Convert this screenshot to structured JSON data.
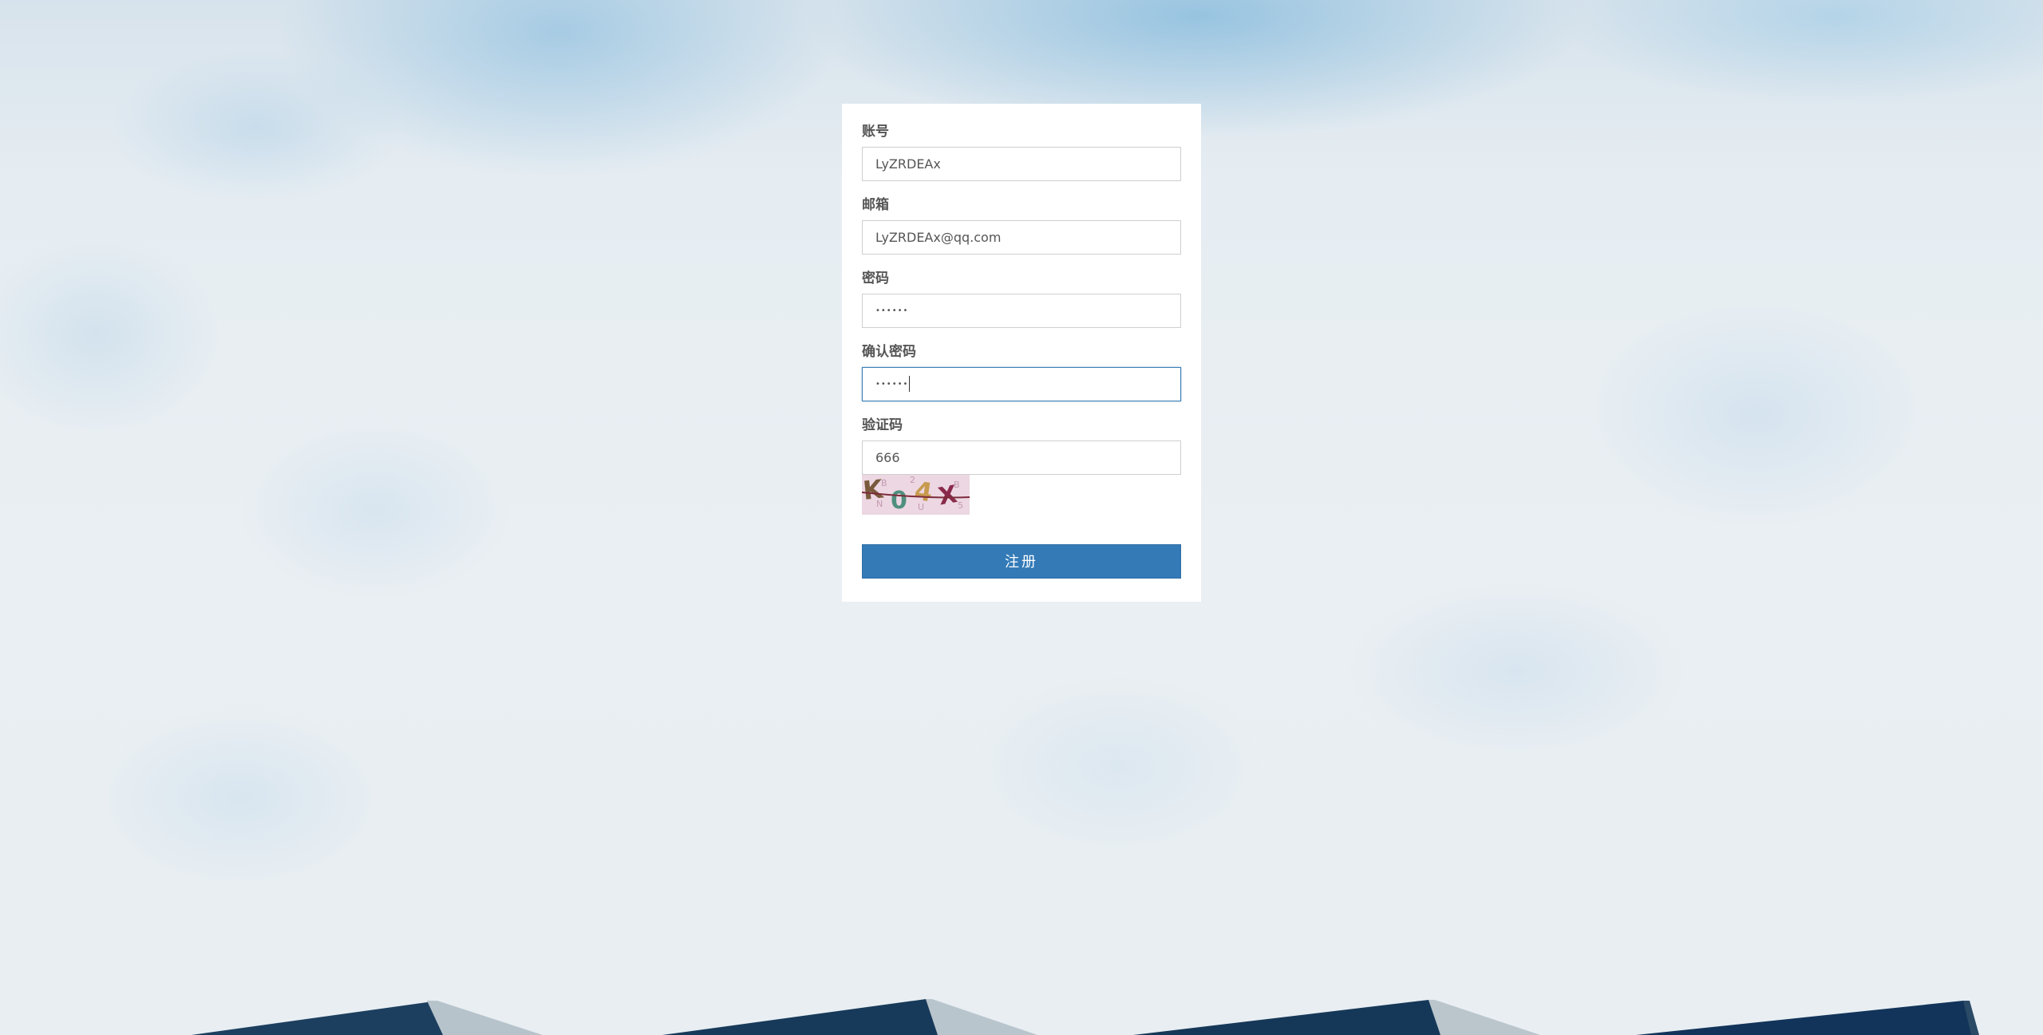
{
  "form": {
    "account": {
      "label": "账号",
      "value": "LyZRDEAx"
    },
    "email": {
      "label": "邮箱",
      "value": "LyZRDEAx@qq.com"
    },
    "password": {
      "label": "密码",
      "value": "••••••"
    },
    "confirm_password": {
      "label": "确认密码",
      "value": "••••••"
    },
    "captcha": {
      "label": "验证码",
      "value": "666",
      "image_text": "K04X"
    },
    "submit_label": "注册"
  },
  "colors": {
    "primary_button": "#337ab7",
    "focus_border": "#3a7fb5",
    "roof": "#12395a"
  }
}
